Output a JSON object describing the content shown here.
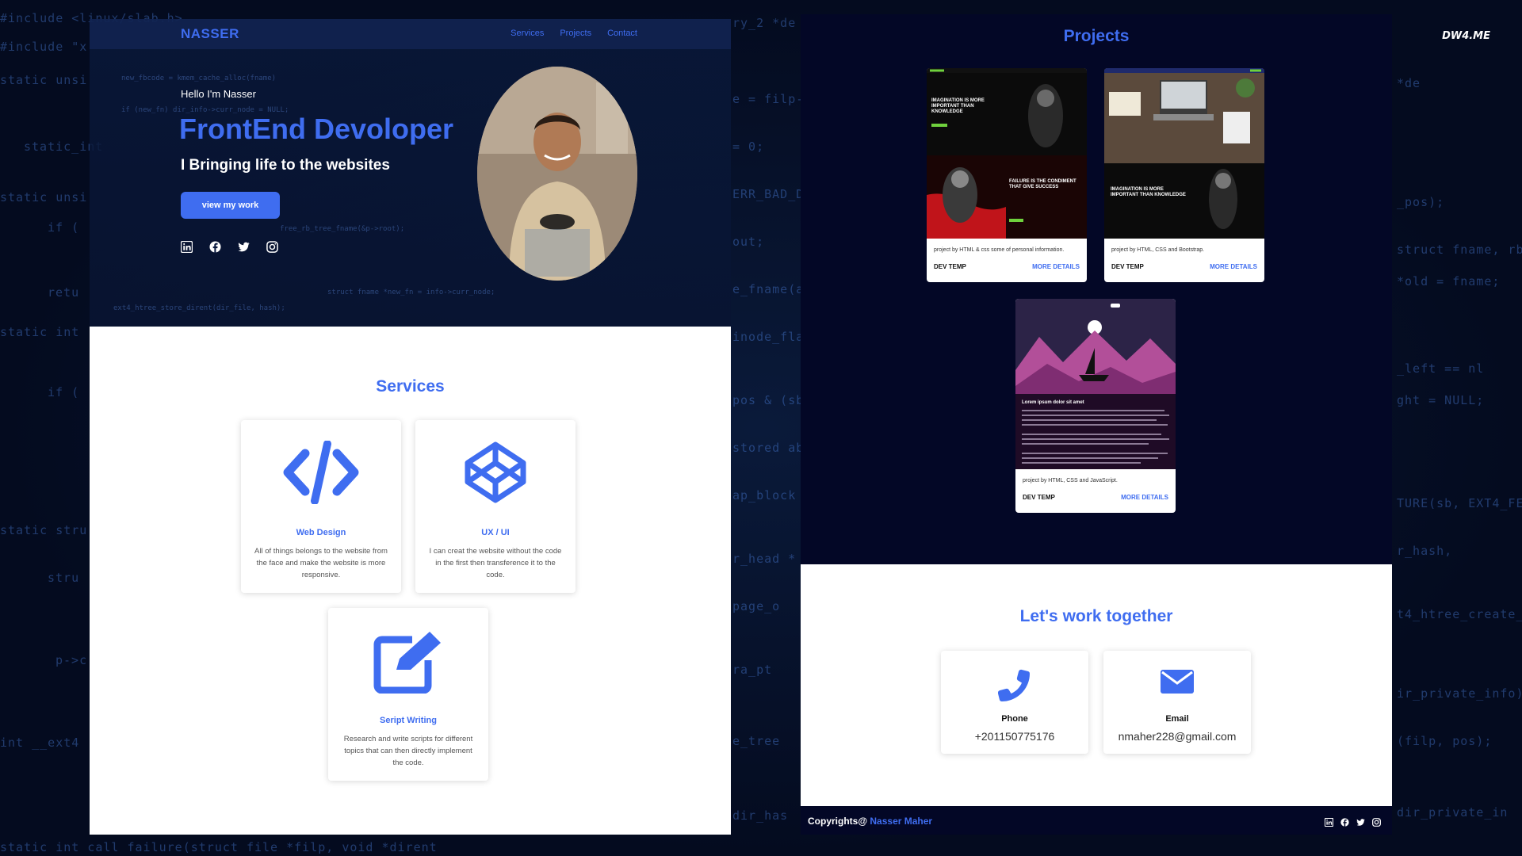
{
  "watermark": "DW4.ME",
  "portfolio": {
    "nav": {
      "brand": "NASSER",
      "links": [
        "Services",
        "Projects",
        "Contact"
      ]
    },
    "hero": {
      "greeting": "Hello I'm Nasser",
      "role": "FrontEnd Devoloper",
      "tagline": "I Bringing life to the websites",
      "cta": "view my work",
      "social_icons": [
        "linkedin-icon",
        "facebook-icon",
        "twitter-icon",
        "instagram-icon"
      ]
    },
    "services": {
      "title": "Services",
      "items": [
        {
          "icon": "code-icon",
          "title": "Web Design",
          "desc": "All of things belongs to the website from the face and make the website is more responsive."
        },
        {
          "icon": "codepen-icon",
          "title": "UX / UI",
          "desc": "I can creat the website without the code in the first then transference it to the code."
        },
        {
          "icon": "edit-icon",
          "title": "Seript Writing",
          "desc": "Research and write scripts for different topics that can then directly implement the code."
        }
      ]
    },
    "projects": {
      "title": "Projects",
      "items": [
        {
          "desc": "project by HTML & css some of personal information.",
          "name": "DEV TEMP",
          "link": "MORE DETAILS",
          "thumb_text_1": "IMAGINATION IS MORE IMPORTANT THAN KNOWLEDGE",
          "thumb_text_2": "FAILURE IS THE CONDIMENT THAT GIVE SUCCESS"
        },
        {
          "desc": "project by HTML, CSS and Bootstrap.",
          "name": "DEV TEMP",
          "link": "MORE DETAILS",
          "thumb_text_1": "IMAGINATION IS MORE IMPORTANT THAN KNOWLEDGE"
        },
        {
          "desc": "project by HTML, CSS and JavaScript.",
          "name": "DEV TEMP",
          "link": "MORE DETAILS",
          "thumb_text_1": "Lorem ipsum dolor sit amet"
        }
      ]
    },
    "contact": {
      "title": "Let's work together",
      "items": [
        {
          "icon": "phone-icon",
          "label": "Phone",
          "value": "+201150775176"
        },
        {
          "icon": "envelope-icon",
          "label": "Email",
          "value": "nmaher228@gmail.com"
        }
      ]
    },
    "footer": {
      "copyright": "Copyrights@",
      "author": "Nasser Maher",
      "social_icons": [
        "linkedin-icon",
        "facebook-icon",
        "twitter-icon",
        "instagram-icon"
      ]
    }
  },
  "colors": {
    "accent": "#3f6df0",
    "dark_bg": "#030726",
    "page_bg": "#040b1f"
  }
}
